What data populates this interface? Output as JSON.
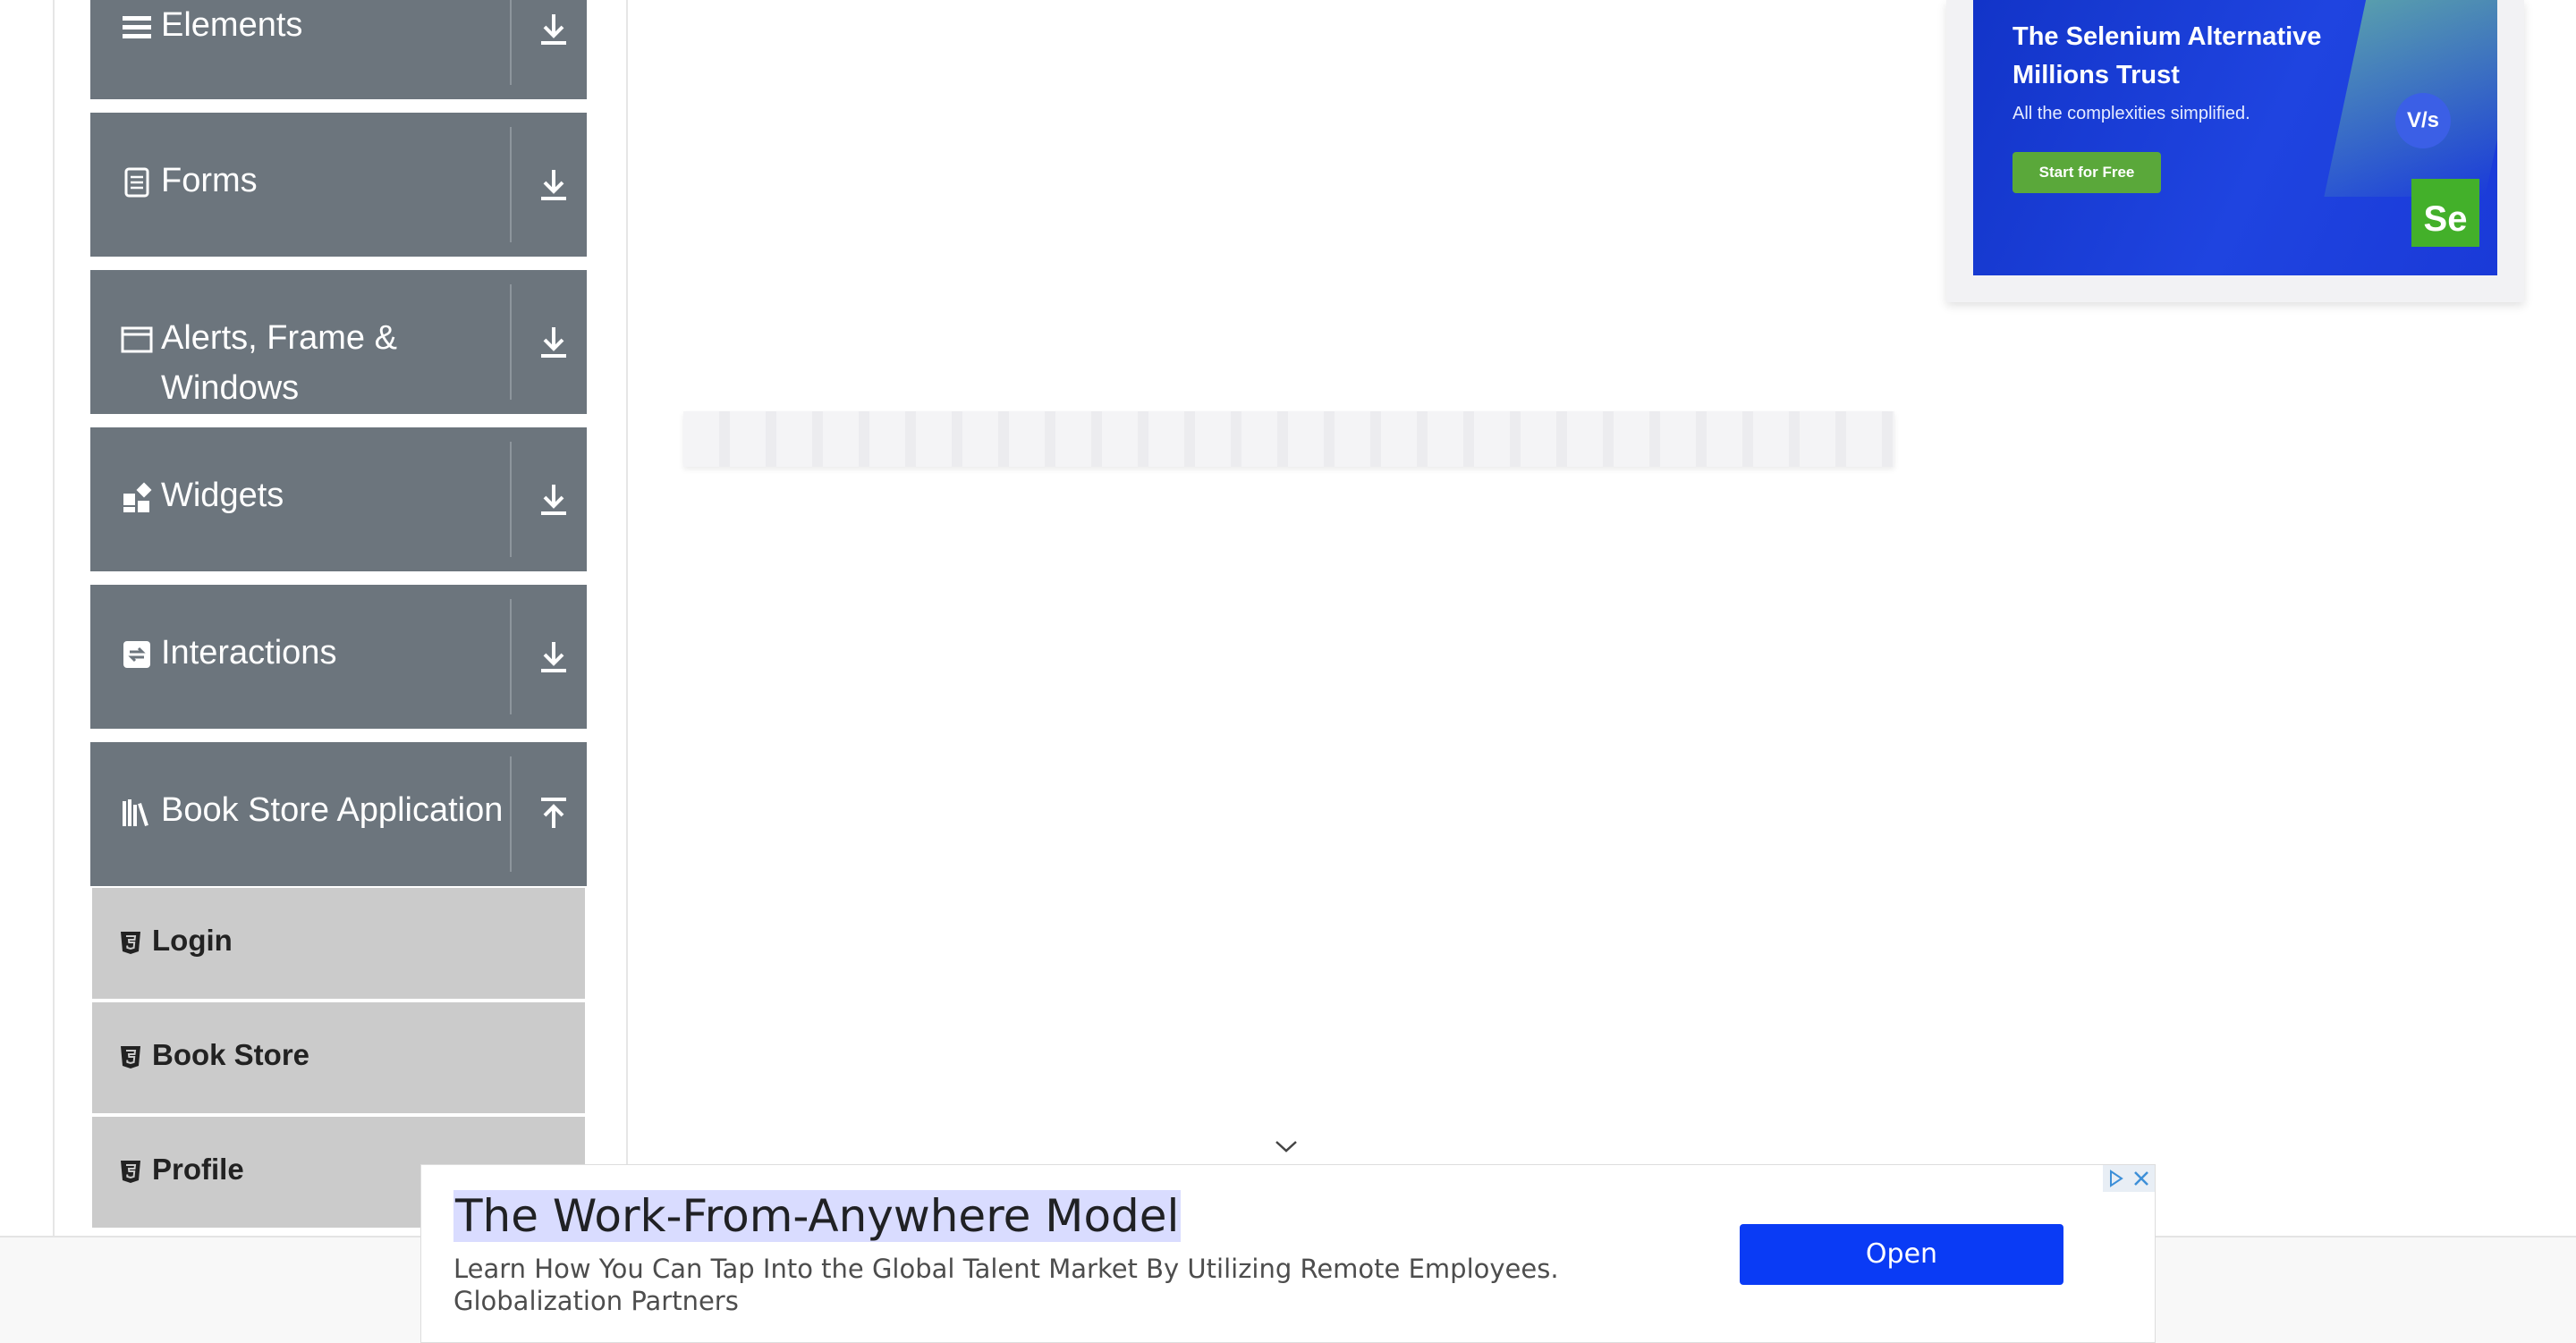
{
  "sidebar": {
    "groups": [
      {
        "label": "Elements",
        "icon": "list-icon",
        "toggle": "expand"
      },
      {
        "label": "Forms",
        "icon": "document-icon",
        "toggle": "expand"
      },
      {
        "label": "Alerts, Frame & Windows",
        "icon": "window-icon",
        "toggle": "expand"
      },
      {
        "label": "Widgets",
        "icon": "widgets-icon",
        "toggle": "expand"
      },
      {
        "label": "Interactions",
        "icon": "interactions-icon",
        "toggle": "expand"
      },
      {
        "label": "Book Store Application",
        "icon": "books-icon",
        "toggle": "collapse"
      }
    ],
    "book_store_items": [
      {
        "label": "Login"
      },
      {
        "label": "Book Store"
      },
      {
        "label": "Profile"
      }
    ]
  },
  "ad_top": {
    "headline": "The Selenium Alternative Millions Trust",
    "subtext": "All the complexities simplified.",
    "cta": "Start for Free",
    "vs_badge": "V/s",
    "logo": "Se",
    "colors": {
      "banner": "#1f44e0",
      "cta": "#5aa83a",
      "logo": "#43b02a"
    }
  },
  "ad_bottom": {
    "title": "The Work-From-Anywhere Model",
    "description": "Learn How You Can Tap Into the Global Talent Market By Utilizing Remote Employees. Globalization Partners",
    "button": "Open",
    "colors": {
      "button": "#0a3bf5"
    }
  },
  "theme": {
    "sidebar_group": "#6c757d",
    "sidebar_item": "#cbcbcb"
  }
}
